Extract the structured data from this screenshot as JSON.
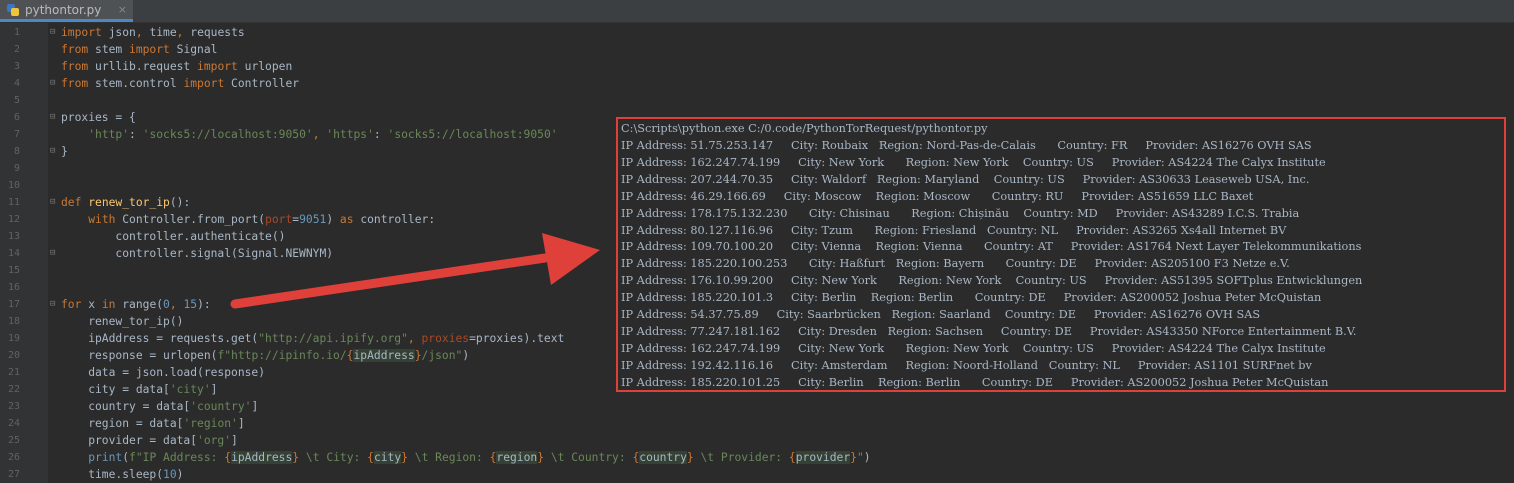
{
  "tab": {
    "filename": "pythontor.py",
    "close": "×"
  },
  "code": [
    {
      "n": "1",
      "fold": "⊟",
      "tokens": [
        [
          "kw",
          "import "
        ],
        [
          "p",
          "json"
        ],
        [
          "kw",
          ", "
        ],
        [
          "p",
          "time"
        ],
        [
          "kw",
          ", "
        ],
        [
          "p",
          "requests"
        ]
      ]
    },
    {
      "n": "2",
      "fold": "",
      "tokens": [
        [
          "kw",
          "from "
        ],
        [
          "p",
          "stem "
        ],
        [
          "kw",
          "import "
        ],
        [
          "p",
          "Signal"
        ]
      ]
    },
    {
      "n": "3",
      "fold": "",
      "tokens": [
        [
          "kw",
          "from "
        ],
        [
          "p",
          "urllib.request "
        ],
        [
          "kw",
          "import "
        ],
        [
          "p",
          "urlopen"
        ]
      ]
    },
    {
      "n": "4",
      "fold": "⊟",
      "tokens": [
        [
          "kw",
          "from "
        ],
        [
          "p",
          "stem.control "
        ],
        [
          "kw",
          "import "
        ],
        [
          "p",
          "Controller"
        ]
      ]
    },
    {
      "n": "5",
      "fold": "",
      "tokens": []
    },
    {
      "n": "6",
      "fold": "⊟",
      "tokens": [
        [
          "p",
          "proxies = {"
        ]
      ]
    },
    {
      "n": "7",
      "fold": "",
      "tokens": [
        [
          "p",
          "    "
        ],
        [
          "st",
          "'http'"
        ],
        [
          "p",
          ": "
        ],
        [
          "st",
          "'socks5://localhost:9050'"
        ],
        [
          "kw",
          ", "
        ],
        [
          "st",
          "'https'"
        ],
        [
          "p",
          ": "
        ],
        [
          "st",
          "'socks5://localhost:9050'"
        ]
      ]
    },
    {
      "n": "8",
      "fold": "⊟",
      "tokens": [
        [
          "p",
          "}"
        ]
      ]
    },
    {
      "n": "9",
      "fold": "",
      "tokens": []
    },
    {
      "n": "10",
      "fold": "",
      "tokens": []
    },
    {
      "n": "11",
      "fold": "⊟",
      "tokens": [
        [
          "kw",
          "def "
        ],
        [
          "fn",
          "renew_tor_ip"
        ],
        [
          "p",
          "():"
        ]
      ]
    },
    {
      "n": "12",
      "fold": "",
      "tokens": [
        [
          "p",
          "    "
        ],
        [
          "kw",
          "with "
        ],
        [
          "p",
          "Controller.from_port("
        ],
        [
          "pr",
          "port"
        ],
        [
          "p",
          "="
        ],
        [
          "nm",
          "9051"
        ],
        [
          "p",
          ") "
        ],
        [
          "kw",
          "as "
        ],
        [
          "p",
          "controller:"
        ]
      ]
    },
    {
      "n": "13",
      "fold": "",
      "tokens": [
        [
          "p",
          "        controller.authenticate()"
        ]
      ]
    },
    {
      "n": "14",
      "fold": "⊟",
      "tokens": [
        [
          "p",
          "        controller.signal(Signal.NEWNYM)"
        ]
      ]
    },
    {
      "n": "15",
      "fold": "",
      "tokens": []
    },
    {
      "n": "16",
      "fold": "",
      "tokens": []
    },
    {
      "n": "17",
      "fold": "⊟",
      "tokens": [
        [
          "kw",
          "for "
        ],
        [
          "p",
          "x "
        ],
        [
          "kw",
          "in "
        ],
        [
          "p",
          "range("
        ],
        [
          "nm",
          "0"
        ],
        [
          "kw",
          ", "
        ],
        [
          "nm",
          "15"
        ],
        [
          "p",
          "):"
        ]
      ]
    },
    {
      "n": "18",
      "fold": "",
      "tokens": [
        [
          "p",
          "    renew_tor_ip()"
        ]
      ]
    },
    {
      "n": "19",
      "fold": "",
      "tokens": [
        [
          "p",
          "    ipAddress = requests.get("
        ],
        [
          "st",
          "\"http://api.ipify.org\""
        ],
        [
          "kw",
          ", "
        ],
        [
          "pr",
          "proxies"
        ],
        [
          "p",
          "=proxies).text"
        ]
      ]
    },
    {
      "n": "20",
      "fold": "",
      "tokens": [
        [
          "p",
          "    response = urlopen("
        ],
        [
          "st",
          "f\"http://ipinfo.io/"
        ],
        [
          "kw",
          "{"
        ],
        [
          "h",
          "ipAddress"
        ],
        [
          "kw",
          "}"
        ],
        [
          "st",
          "/json\""
        ],
        [
          "p",
          ")"
        ]
      ]
    },
    {
      "n": "21",
      "fold": "",
      "tokens": [
        [
          "p",
          "    data = json.load(response)"
        ]
      ]
    },
    {
      "n": "22",
      "fold": "",
      "tokens": [
        [
          "p",
          "    city = data["
        ],
        [
          "st",
          "'city'"
        ],
        [
          "p",
          "]"
        ]
      ]
    },
    {
      "n": "23",
      "fold": "",
      "tokens": [
        [
          "p",
          "    country = data["
        ],
        [
          "st",
          "'country'"
        ],
        [
          "p",
          "]"
        ]
      ]
    },
    {
      "n": "24",
      "fold": "",
      "tokens": [
        [
          "p",
          "    region = data["
        ],
        [
          "st",
          "'region'"
        ],
        [
          "p",
          "]"
        ]
      ]
    },
    {
      "n": "25",
      "fold": "",
      "tokens": [
        [
          "p",
          "    provider = data["
        ],
        [
          "st",
          "'org'"
        ],
        [
          "p",
          "]"
        ]
      ]
    },
    {
      "n": "26",
      "fold": "",
      "tokens": [
        [
          "p",
          "    "
        ],
        [
          "nm",
          "print"
        ],
        [
          "p",
          "("
        ],
        [
          "st",
          "f\"IP Address: "
        ],
        [
          "kw",
          "{"
        ],
        [
          "h",
          "ipAddress"
        ],
        [
          "kw",
          "}"
        ],
        [
          "st",
          " \\t City: "
        ],
        [
          "kw",
          "{"
        ],
        [
          "h",
          "city"
        ],
        [
          "kw",
          "}"
        ],
        [
          "st",
          " \\t Region: "
        ],
        [
          "kw",
          "{"
        ],
        [
          "h",
          "region"
        ],
        [
          "kw",
          "}"
        ],
        [
          "st",
          " \\t Country: "
        ],
        [
          "kw",
          "{"
        ],
        [
          "h",
          "country"
        ],
        [
          "kw",
          "}"
        ],
        [
          "st",
          " \\t Provider: "
        ],
        [
          "kw",
          "{"
        ],
        [
          "h",
          "provider"
        ],
        [
          "kw",
          "}"
        ],
        [
          "st",
          "\""
        ],
        [
          "p",
          ")"
        ]
      ]
    },
    {
      "n": "27",
      "fold": "",
      "tokens": [
        [
          "p",
          "    time.sleep("
        ],
        [
          "nm",
          "10"
        ],
        [
          "p",
          ")"
        ]
      ]
    }
  ],
  "console": {
    "command": "C:\\Scripts\\python.exe C:/0.code/PythonTorRequest/pythontor.py",
    "lines": [
      "IP Address: 51.75.253.147     City: Roubaix   Region: Nord-Pas-de-Calais      Country: FR     Provider: AS16276 OVH SAS",
      "IP Address: 162.247.74.199     City: New York      Region: New York    Country: US     Provider: AS4224 The Calyx Institute",
      "IP Address: 207.244.70.35     City: Waldorf   Region: Maryland    Country: US     Provider: AS30633 Leaseweb USA, Inc.",
      "IP Address: 46.29.166.69     City: Moscow    Region: Moscow      Country: RU     Provider: AS51659 LLC Baxet",
      "IP Address: 178.175.132.230      City: Chisinau      Region: Chișinău    Country: MD     Provider: AS43289 I.C.S. Trabia",
      "IP Address: 80.127.116.96     City: Tzum      Region: Friesland   Country: NL     Provider: AS3265 Xs4all Internet BV",
      "IP Address: 109.70.100.20     City: Vienna    Region: Vienna      Country: AT     Provider: AS1764 Next Layer Telekommunikations",
      "IP Address: 185.220.100.253      City: Haßfurt   Region: Bayern      Country: DE     Provider: AS205100 F3 Netze e.V.",
      "IP Address: 176.10.99.200     City: New York      Region: New York    Country: US     Provider: AS51395 SOFTplus Entwicklungen",
      "IP Address: 185.220.101.3     City: Berlin    Region: Berlin      Country: DE     Provider: AS200052 Joshua Peter McQuistan",
      "IP Address: 54.37.75.89     City: Saarbrücken   Region: Saarland    Country: DE     Provider: AS16276 OVH SAS",
      "IP Address: 77.247.181.162     City: Dresden   Region: Sachsen     Country: DE     Provider: AS43350 NForce Entertainment B.V.",
      "IP Address: 162.247.74.199     City: New York      Region: New York    Country: US     Provider: AS4224 The Calyx Institute",
      "IP Address: 192.42.116.16     City: Amsterdam     Region: Noord-Holland   Country: NL     Provider: AS1101 SURFnet bv",
      "IP Address: 185.220.101.25     City: Berlin    Region: Berlin      Country: DE     Provider: AS200052 Joshua Peter McQuistan"
    ]
  },
  "colors": {
    "annotation": "#e0403a",
    "keyword": "#cc7832",
    "string": "#6a8759",
    "number": "#6897bb"
  },
  "icons": {
    "file": "python-file-icon",
    "arrow": "annotation-arrow-icon"
  }
}
